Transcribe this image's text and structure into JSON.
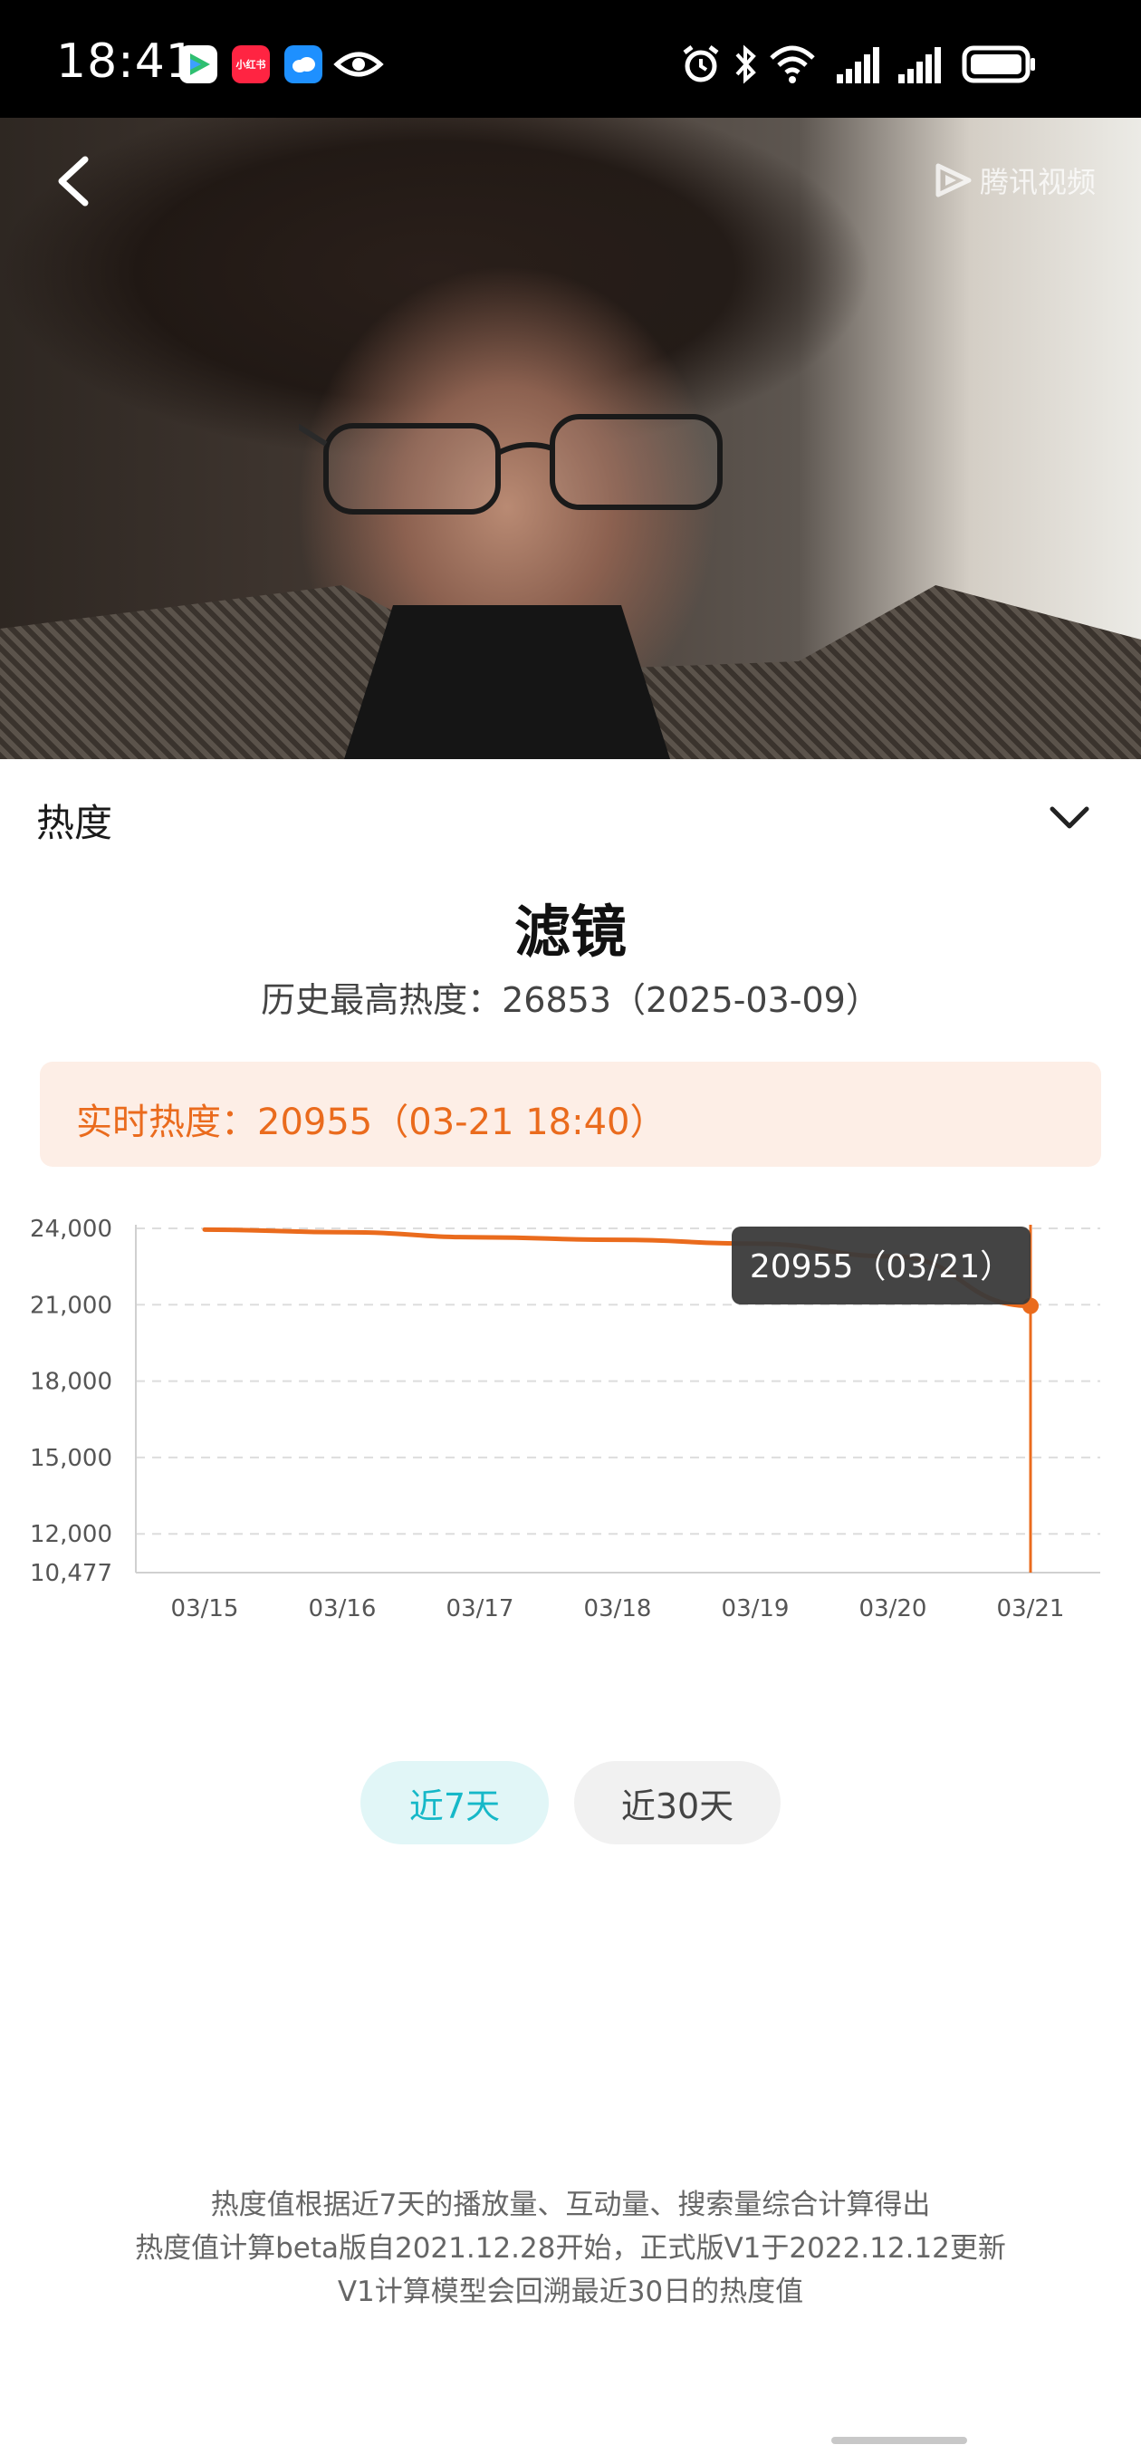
{
  "status_bar": {
    "time": "18:41",
    "app_icons": [
      {
        "name": "video-app-icon",
        "color": "#2fbf71",
        "label": ""
      },
      {
        "name": "xiaohongshu-icon",
        "color": "#ff2442",
        "label": "小红书"
      },
      {
        "name": "cloud-app-icon",
        "color": "#1e90ff",
        "label": ""
      },
      {
        "name": "eye-icon",
        "color": "#ffffff",
        "label": ""
      }
    ],
    "right_icons": [
      "alarm-icon",
      "bluetooth-icon",
      "wifi-icon",
      "signal-icon",
      "signal-icon",
      "battery-icon"
    ]
  },
  "hero": {
    "watermark": "腾讯视频"
  },
  "heat": {
    "section_title": "热度",
    "show_title": "滤镜",
    "history_high": "历史最高热度：26853（2025-03-09）",
    "realtime": "实时热度：20955（03-21 18:40）"
  },
  "chart_data": {
    "type": "line",
    "x": [
      "03/15",
      "03/16",
      "03/17",
      "03/18",
      "03/19",
      "03/20",
      "03/21"
    ],
    "series": [
      {
        "values": [
          23950,
          23850,
          23650,
          23550,
          23400,
          22900,
          20955
        ],
        "color": "#ea6b1d"
      }
    ],
    "yticks": [
      "24,000",
      "21,000",
      "18,000",
      "15,000",
      "12,000",
      "10,477"
    ],
    "ytick_values": [
      24000,
      21000,
      18000,
      15000,
      12000,
      10477
    ],
    "ylim": [
      10477,
      24000
    ],
    "grid": true,
    "tooltip": "20955（03/21）"
  },
  "range_tabs": {
    "tab_7": "近7天",
    "tab_30": "近30天",
    "active": "tab_7"
  },
  "footnote": {
    "line1": "热度值根据近7天的播放量、互动量、搜索量综合计算得出",
    "line2": "热度值计算beta版自2021.12.28开始，正式版V1于2022.12.12更新",
    "line3": "V1计算模型会回溯最近30日的热度值"
  }
}
